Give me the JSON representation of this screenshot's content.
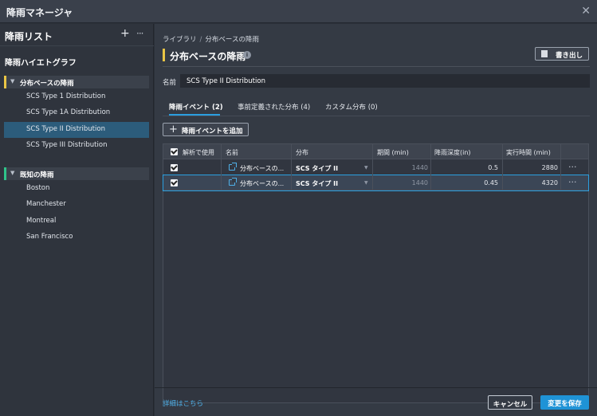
{
  "window": {
    "title": "降雨マネージャ",
    "close_icon": "close-icon"
  },
  "left": {
    "header": "降雨リスト",
    "section_title": "降雨ハイエトグラフ",
    "groups": [
      {
        "label": "分布ベースの降雨",
        "color": "#e9c545",
        "items": [
          {
            "label": "SCS Type 1 Distribution",
            "selected": false
          },
          {
            "label": "SCS Type 1A Distribution",
            "selected": false
          },
          {
            "label": "SCS Type II Distribution",
            "selected": true
          },
          {
            "label": "SCS Type III Distribution",
            "selected": false
          }
        ]
      },
      {
        "label": "既知の降雨",
        "color": "#2fc48a",
        "items": [
          {
            "label": "Boston"
          },
          {
            "label": "Manchester"
          },
          {
            "label": "Montreal"
          },
          {
            "label": "San Francisco"
          }
        ]
      }
    ]
  },
  "main": {
    "breadcrumb": [
      "ライブラリ",
      "分布ベースの降雨"
    ],
    "title": "分布ベースの降雨",
    "export_label": "書き出し",
    "name_label": "名前",
    "name_value": "SCS Type II Distribution",
    "tabs": [
      {
        "label": "降雨イベント (2)",
        "active": true
      },
      {
        "label": "事前定義された分布 (4)",
        "active": false
      },
      {
        "label": "カスタム分布 (0)",
        "active": false
      }
    ],
    "add_button": "降雨イベントを追加",
    "table": {
      "headers": [
        "解析で使用",
        "名前",
        "分布",
        "期間 (min)",
        "降雨深度(in)",
        "実行時間 (min)"
      ],
      "rows": [
        {
          "checked": true,
          "name": "分布ベースの...",
          "distribution": "SCS タイプ II",
          "duration": "1440",
          "depth": "0.5",
          "runtime": "2880",
          "selected": false
        },
        {
          "checked": true,
          "name": "分布ベースの...",
          "distribution": "SCS タイプ II",
          "duration": "1440",
          "depth": "0.45",
          "runtime": "4320",
          "selected": true
        }
      ]
    },
    "footer": {
      "link": "詳細はこちら",
      "cancel": "キャンセル",
      "save": "変更を保存"
    }
  },
  "colors": {
    "accent": "#1f93d6",
    "selection": "#2c5c7b"
  }
}
